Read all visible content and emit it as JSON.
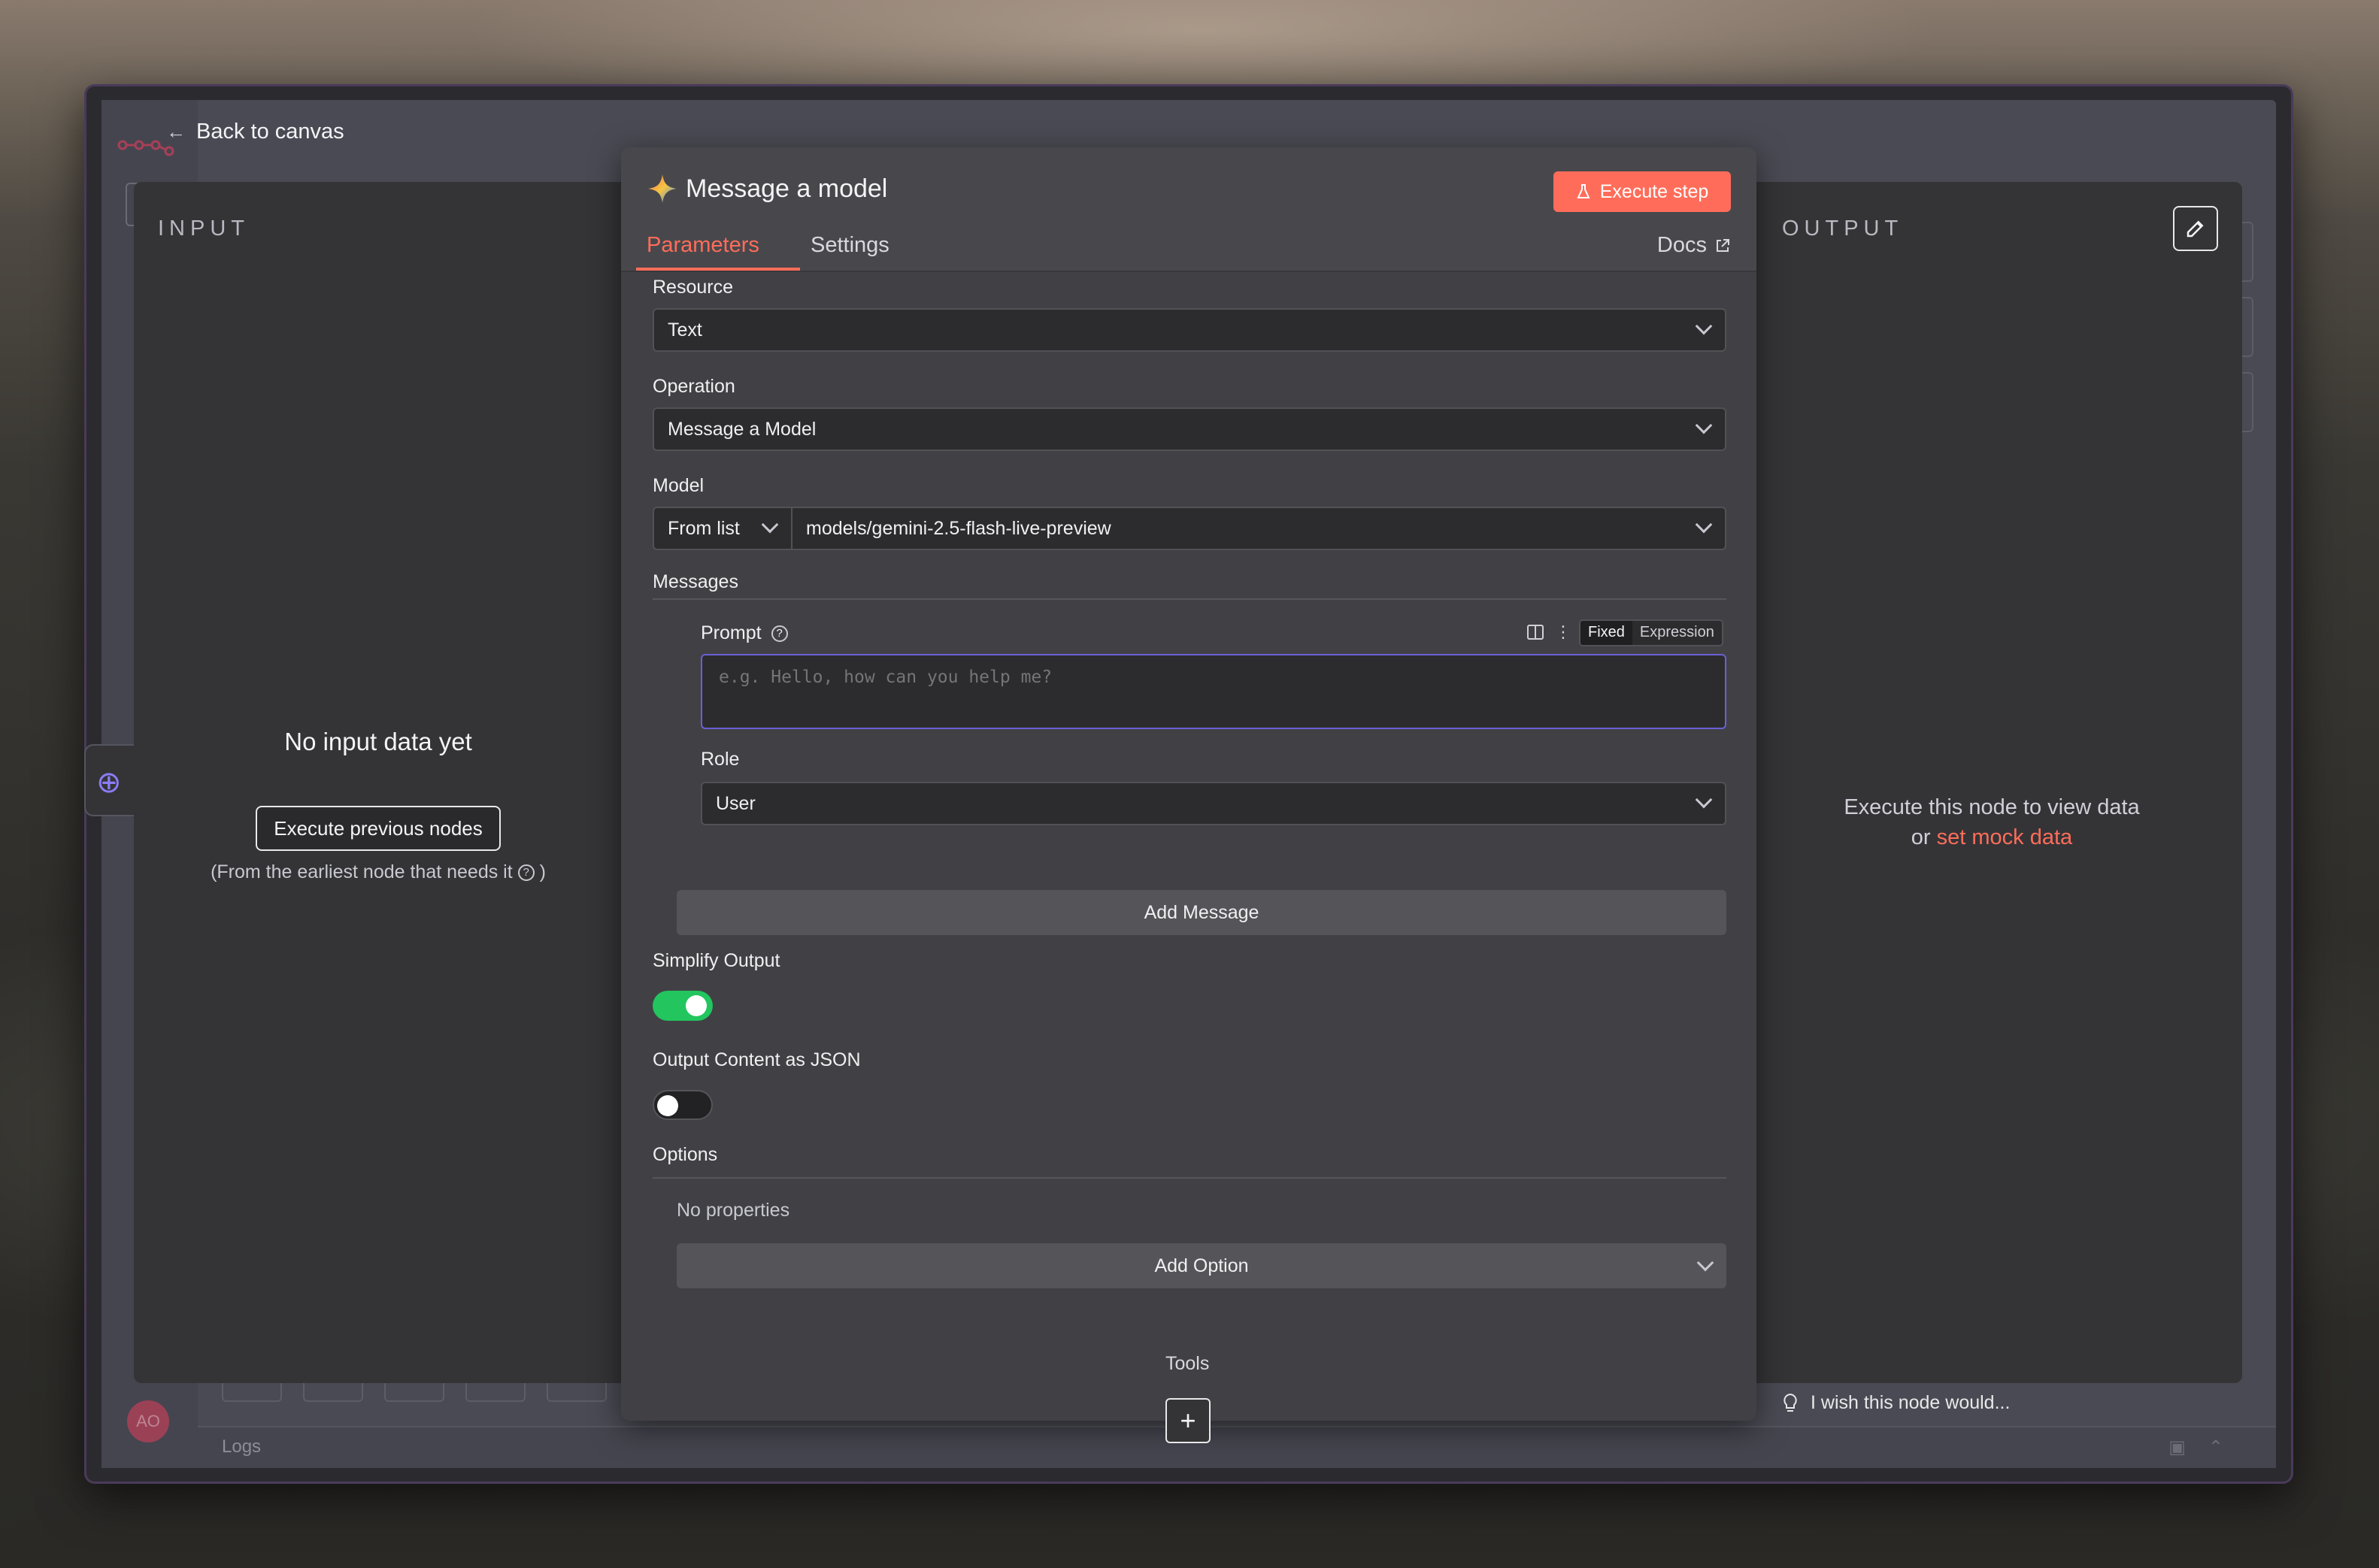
{
  "nav": {
    "back_label": "Back to canvas"
  },
  "input": {
    "title": "INPUT",
    "empty_title": "No input data yet",
    "execute_previous_label": "Execute previous nodes",
    "note_prefix": "(From the earliest node that needs it",
    "note_suffix": ")"
  },
  "output": {
    "title": "OUTPUT",
    "message_line1": "Execute this node to view data",
    "message_or": "or",
    "mock_link": "set mock data"
  },
  "node": {
    "title": "Message a model",
    "execute_label": "Execute step",
    "tabs": [
      "Parameters",
      "Settings"
    ],
    "docs_label": "Docs"
  },
  "params": {
    "resource_label": "Resource",
    "resource_value": "Text",
    "operation_label": "Operation",
    "operation_value": "Message a Model",
    "model_label": "Model",
    "model_mode": "From list",
    "model_value": "models/gemini-2.5-flash-live-preview",
    "messages_label": "Messages",
    "prompt_label": "Prompt",
    "prompt_placeholder": "e.g. Hello, how can you help me?",
    "mode_fixed": "Fixed",
    "mode_expression": "Expression",
    "role_label": "Role",
    "role_value": "User",
    "add_message_label": "Add Message",
    "simplify_label": "Simplify Output",
    "simplify_on": true,
    "json_label": "Output Content as JSON",
    "json_on": false,
    "options_label": "Options",
    "no_properties": "No properties",
    "add_option_label": "Add Option",
    "tools_label": "Tools",
    "plus_label": "+"
  },
  "footer": {
    "wish_label": "I wish this node would...",
    "logs_label": "Logs",
    "avatar_initials": "AO"
  },
  "colors": {
    "accent": "#ff6d5a",
    "toggle_on": "#22c55e",
    "focus_border": "#6b5fd6"
  },
  "icons": [
    "back-arrow-icon",
    "gemini-icon",
    "flask-icon",
    "external-link-icon",
    "help-icon",
    "pencil-icon",
    "globe-icon",
    "lightbulb-icon",
    "chevron-down-icon",
    "panel-icon",
    "more-icon"
  ]
}
